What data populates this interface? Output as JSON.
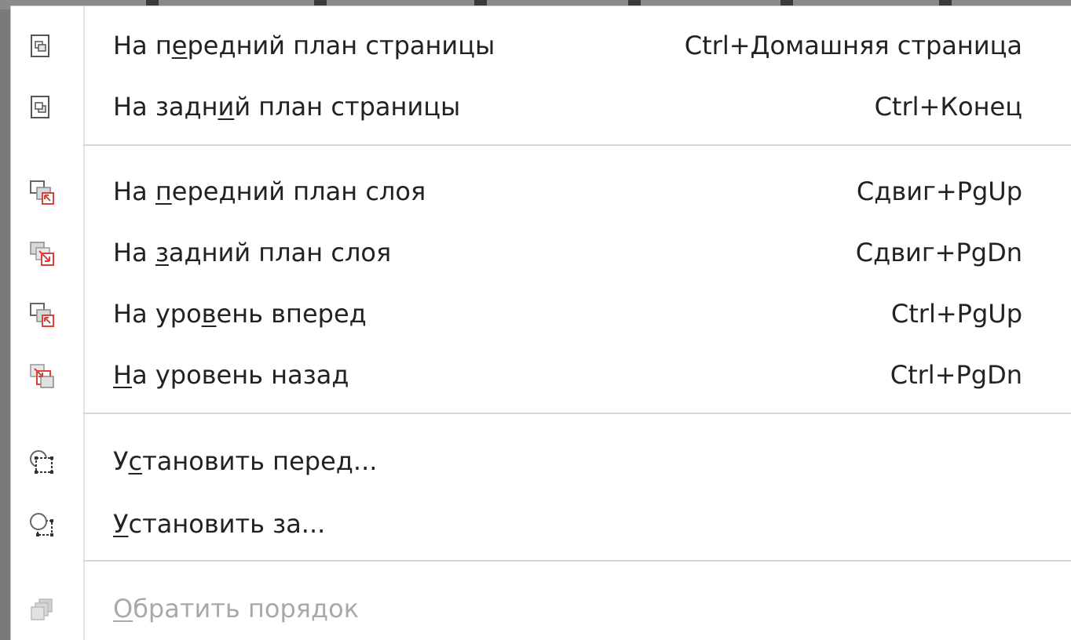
{
  "menu": {
    "items": [
      {
        "pre": "На п",
        "mn": "е",
        "post": "редний план страницы",
        "shortcut": "Ctrl+Домашняя страница",
        "icon": "page-front-icon",
        "enabled": true
      },
      {
        "pre": "На задн",
        "mn": "и",
        "post": "й план страницы",
        "shortcut": "Ctrl+Конец",
        "icon": "page-back-icon",
        "enabled": true
      },
      {
        "pre": "На ",
        "mn": "п",
        "post": "ередний план слоя",
        "shortcut": "Сдвиг+PgUp",
        "icon": "layer-front-icon",
        "enabled": true
      },
      {
        "pre": "На ",
        "mn": "з",
        "post": "адний план слоя",
        "shortcut": "Сдвиг+PgDn",
        "icon": "layer-back-icon",
        "enabled": true
      },
      {
        "pre": "На уро",
        "mn": "в",
        "post": "ень вперед",
        "shortcut": "Ctrl+PgUp",
        "icon": "forward-one-icon",
        "enabled": true
      },
      {
        "pre": "",
        "mn": "Н",
        "post": "а уровень назад",
        "shortcut": "Ctrl+PgDn",
        "icon": "back-one-icon",
        "enabled": true
      },
      {
        "pre": "У",
        "mn": "с",
        "post": "тановить перед...",
        "shortcut": "",
        "icon": "place-in-front-icon",
        "enabled": true
      },
      {
        "pre": "",
        "mn": "У",
        "post": "становить за...",
        "shortcut": "",
        "icon": "place-behind-icon",
        "enabled": true
      },
      {
        "pre": "",
        "mn": "О",
        "post": "братить порядок",
        "shortcut": "",
        "icon": "reverse-order-icon",
        "enabled": false
      }
    ]
  },
  "colors": {
    "accent_red": "#d9413a",
    "icon_gray": "#6d6d6d",
    "disabled_text": "#a9a9a9"
  }
}
